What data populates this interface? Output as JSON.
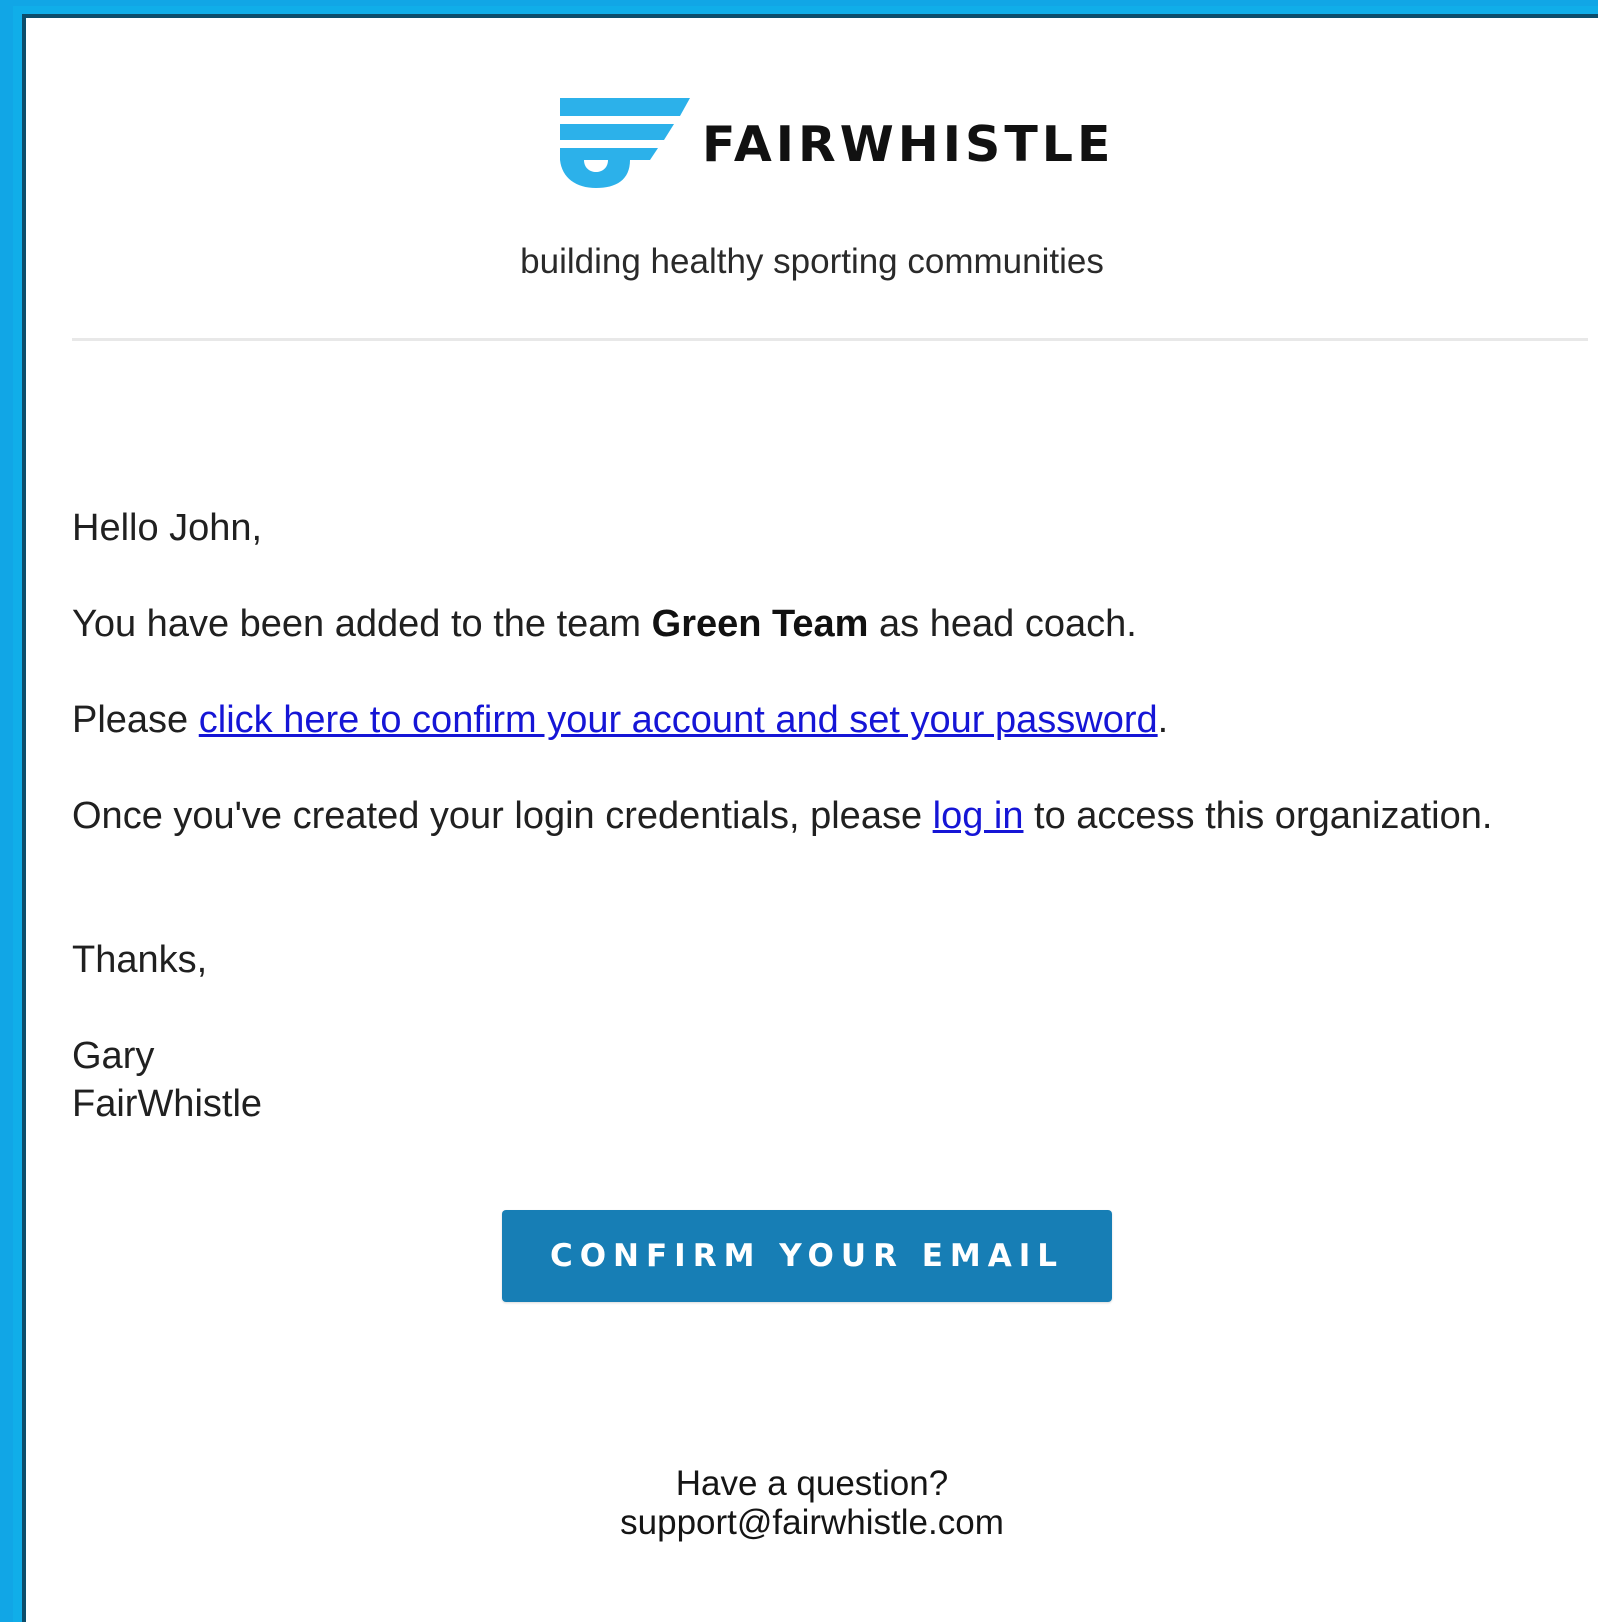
{
  "brand": {
    "name": "FAIRWHISTLE",
    "tagline": "building healthy sporting communities",
    "logo_icon": "fairwhistle-whistle-logo",
    "colors": {
      "frame": "#11a6e6",
      "logo_blue": "#2cb1ea",
      "button": "#177eb5",
      "link": "#1515d6"
    }
  },
  "message": {
    "greeting": "Hello John,",
    "added_prefix": "You have been added to the team ",
    "team_name": "Green Team",
    "added_suffix": " as head coach.",
    "please_prefix": "Please ",
    "confirm_link": "click here to confirm your account and set your password",
    "please_suffix": ".",
    "once_prefix": "Once you've created your login credentials, please ",
    "login_link": "log in",
    "once_suffix": " to access this organization.",
    "thanks": "Thanks,",
    "signature_name": "Gary",
    "signature_org": "FairWhistle"
  },
  "cta": {
    "label": "CONFIRM YOUR EMAIL"
  },
  "footer": {
    "question": "Have a question?",
    "email": "support@fairwhistle.com"
  }
}
